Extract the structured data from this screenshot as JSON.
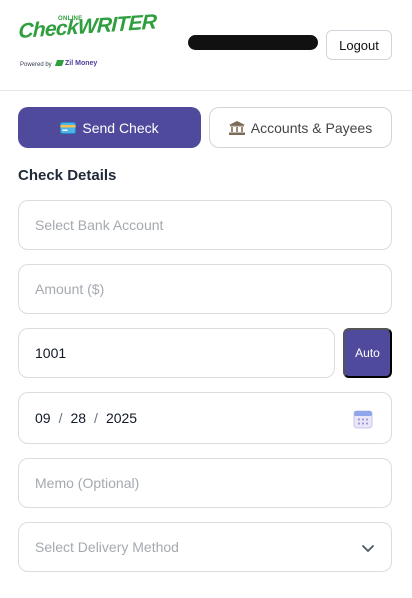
{
  "brand": {
    "online": "ONLINE",
    "name": "CheckWRITER",
    "powered_by": "Powered by",
    "partner": "Zil Money"
  },
  "header": {
    "logout_label": "Logout"
  },
  "tabs": [
    {
      "label": "Send Check",
      "icon": "credit-card-icon",
      "active": true
    },
    {
      "label": "Accounts & Payees",
      "icon": "bank-icon",
      "active": false
    }
  ],
  "form": {
    "title": "Check Details",
    "bank_placeholder": "Select Bank Account",
    "amount_placeholder": "Amount ($)",
    "check_number": "1001",
    "auto_label": "Auto",
    "date": {
      "month": "09",
      "day": "28",
      "year": "2025"
    },
    "memo_placeholder": "Memo (Optional)",
    "delivery_placeholder": "Select Delivery Method"
  },
  "colors": {
    "primary": "#4f4a9c",
    "brand_green": "#2e9e3e"
  }
}
